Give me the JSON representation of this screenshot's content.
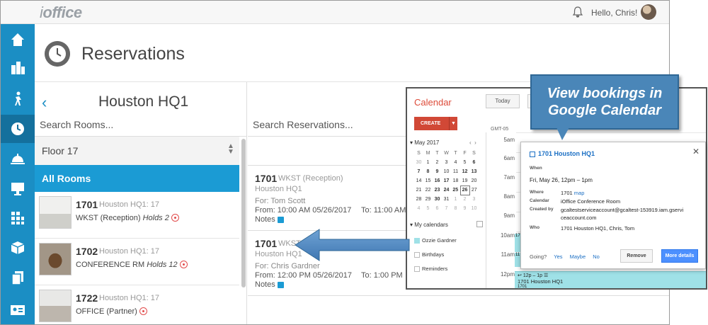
{
  "header": {
    "logo": "office",
    "greeting": "Hello, Chris!",
    "page_title": "Reservations"
  },
  "left_panel": {
    "location": "Houston HQ1",
    "search_placeholder": "Search Rooms...",
    "floor_label": "Floor  17",
    "all_rooms": "All Rooms",
    "rooms": [
      {
        "num": "1701",
        "loc": "Houston HQ1: 17",
        "type": "WKST (Reception)",
        "holds": "Holds 2"
      },
      {
        "num": "1702",
        "loc": "Houston HQ1: 17",
        "type": "CONFERENCE RM",
        "holds": "Holds 12"
      },
      {
        "num": "1722",
        "loc": "Houston HQ1: 17",
        "type": "OFFICE (Partner)",
        "holds": ""
      }
    ]
  },
  "reservations": {
    "search_placeholder": "Search Reservations...",
    "items": [
      {
        "num": "1701",
        "type": "WKST (Reception)",
        "loc": "Houston HQ1",
        "for": "For: Tom Scott",
        "from": "From: 10:00 AM 05/26/2017",
        "to": "To: 11:00 AM",
        "notes": "Notes"
      },
      {
        "num": "1701",
        "type": "WKST (Reception)",
        "loc": "Houston HQ1",
        "for": "For: Chris Gardner",
        "from": "From: 12:00 PM 05/26/2017",
        "to": "To: 1:00 PM",
        "notes": "Notes"
      }
    ]
  },
  "calendar": {
    "title": "Calendar",
    "today": "Today",
    "create": "CREATE",
    "gmt": "GMT-05",
    "month": "May 2017",
    "weekdays": [
      "S",
      "M",
      "T",
      "W",
      "T",
      "F",
      "S"
    ],
    "weeks": [
      [
        "30",
        "1",
        "2",
        "3",
        "4",
        "5",
        "6"
      ],
      [
        "7",
        "8",
        "9",
        "10",
        "11",
        "12",
        "13"
      ],
      [
        "14",
        "15",
        "16",
        "17",
        "18",
        "19",
        "20"
      ],
      [
        "21",
        "22",
        "23",
        "24",
        "25",
        "26",
        "27"
      ],
      [
        "28",
        "29",
        "30",
        "31",
        "1",
        "2",
        "3"
      ],
      [
        "4",
        "5",
        "6",
        "7",
        "8",
        "9",
        "10"
      ]
    ],
    "my_calendars": "My calendars",
    "calendar_list": [
      "Ozzie Gardner",
      "Birthdays",
      "Reminders"
    ],
    "hours": [
      "5am",
      "6am",
      "7am",
      "8am",
      "9am",
      "10am",
      "11am",
      "12pm"
    ],
    "small_events": [
      "17",
      "11"
    ],
    "event": {
      "time": "12p – 1p",
      "title": "1701 Houston HQ1",
      "sub": "1701"
    }
  },
  "popup": {
    "title": "1701 Houston HQ1",
    "when_label": "When",
    "date": "Fri, May 26, 12pm – 1pm",
    "where_label": "Where",
    "where_value": "1701",
    "map": "map",
    "calendar_label": "Calendar",
    "calendar_value": "iOffice Conference Room",
    "created_label": "Created by",
    "created_value": "gcaltestserviceaccount@gcaltest-153919.iam.gserviceaccount.com",
    "who_label": "Who",
    "who_value": "1701 Houston HQ1, Chris, Tom",
    "going": "Going?",
    "yes": "Yes",
    "maybe": "Maybe",
    "no": "No",
    "remove": "Remove",
    "more": "More details"
  },
  "callout": "View bookings in Google Calendar",
  "colors": {
    "sidebar": "#1b8ec4",
    "accent": "#1b9bd4",
    "calendar_red": "#dd4b39",
    "callout": "#4a86b8"
  }
}
